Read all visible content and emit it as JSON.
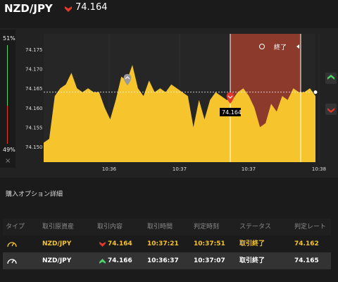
{
  "header": {
    "pair": "NZD/JPY",
    "rate": "74.164",
    "direction_icon": "down-arrow-icon"
  },
  "sidebar": {
    "top_percent": "51%",
    "bottom_percent": "49%",
    "close_glyph": "×"
  },
  "expired_label": "終了",
  "current_rate_tag": "74.164",
  "colors": {
    "accent_yellow": "#f6c42c",
    "down_red": "#e0392b",
    "up_green": "#4fd36a",
    "expired_band": "#8b3a2c"
  },
  "chart_data": {
    "type": "area",
    "x_tick_labels": [
      "10:36",
      "10:37",
      "10:37",
      "10:38"
    ],
    "y_tick_labels": [
      "74.175",
      "74.170",
      "74.165",
      "74.160",
      "74.155",
      "74.150"
    ],
    "ylim": [
      74.146,
      74.179
    ],
    "current_value": 74.164,
    "values": [
      74.151,
      74.152,
      74.163,
      74.165,
      74.166,
      74.169,
      74.165,
      74.164,
      74.165,
      74.164,
      74.164,
      74.16,
      74.157,
      74.162,
      74.168,
      74.167,
      74.171,
      74.165,
      74.163,
      74.167,
      74.164,
      74.165,
      74.164,
      74.166,
      74.165,
      74.164,
      74.163,
      74.155,
      74.162,
      74.157,
      74.162,
      74.164,
      74.163,
      74.162,
      74.162,
      74.164,
      74.165,
      74.163,
      74.16,
      74.155,
      74.156,
      74.161,
      74.159,
      74.163,
      74.162,
      74.165,
      74.164,
      74.164,
      74.165,
      74.163
    ]
  },
  "section_title": "購入オプション詳細",
  "table": {
    "headers": [
      "タイプ",
      "取引原資産",
      "取引内容",
      "取引時間",
      "判定時刻",
      "ステータス",
      "判定レート"
    ],
    "rows": [
      {
        "type_icon": "gauge-icon",
        "asset": "NZD/JPY",
        "direction_icon": "down-arrow-icon",
        "rate": "74.164",
        "time": "10:37:21",
        "judge_time": "10:37:51",
        "status": "取引終了",
        "judge_rate": "74.162"
      },
      {
        "type_icon": "gauge-icon",
        "asset": "NZD/JPY",
        "direction_icon": "up-arrow-icon",
        "rate": "74.166",
        "time": "10:36:37",
        "judge_time": "10:37:07",
        "status": "取引終了",
        "judge_rate": "74.165"
      }
    ]
  }
}
